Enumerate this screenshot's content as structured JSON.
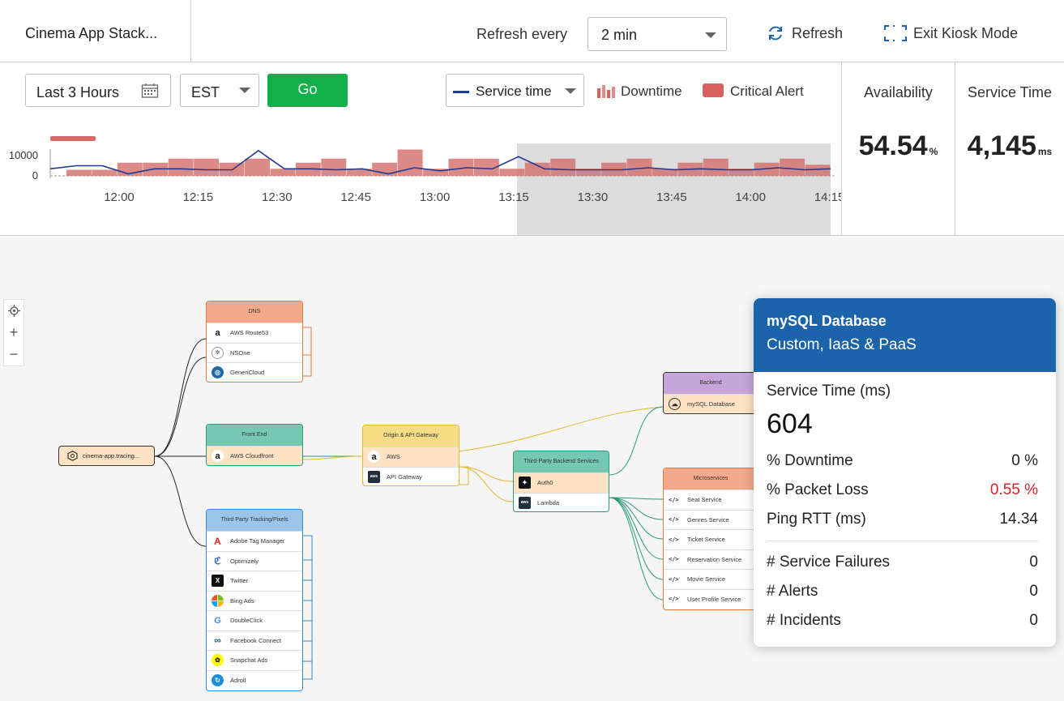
{
  "header": {
    "app_title": "Cinema App Stack...",
    "refresh_label": "Refresh every",
    "refresh_interval": "2 min",
    "refresh_button": "Refresh",
    "kiosk_button": "Exit Kiosk Mode"
  },
  "filters": {
    "range": "Last 3 Hours",
    "timezone": "EST",
    "go_button": "Go",
    "series_select": "Service time",
    "legend_downtime": "Downtime",
    "legend_critical": "Critical Alert"
  },
  "kpis": {
    "availability_label": "Availability",
    "availability_value": "54.54",
    "availability_unit": "%",
    "service_time_label": "Service Time",
    "service_time_value": "4,145",
    "service_time_unit": "ms"
  },
  "chart_data": {
    "type": "bar",
    "y_ticks": [
      "10000",
      "0"
    ],
    "x_ticks": [
      "12:00",
      "12:15",
      "12:30",
      "12:45",
      "13:00",
      "13:15",
      "13:30",
      "13:45",
      "14:00",
      "14:15"
    ],
    "downtime_bars": [
      0.3,
      0.3,
      0.65,
      0.65,
      0.85,
      0.85,
      0.65,
      0.85,
      0.35,
      0.65,
      0.85,
      0.35,
      0.65,
      1.3,
      0.35,
      0.85,
      0.85,
      0.35,
      0.65,
      0.85,
      0.35,
      0.65,
      0.85,
      0.35,
      0.65,
      0.85,
      0.35,
      0.65,
      0.85,
      0.55
    ],
    "service_time_line": [
      3500,
      5000,
      5000,
      1000,
      3500,
      3500,
      3000,
      3000,
      12500,
      3500,
      3500,
      3000,
      3500,
      1000,
      4000,
      2500,
      4000,
      3500,
      9500,
      3500,
      3000,
      3000,
      3000,
      4000,
      3000,
      3500,
      3000,
      3000,
      4000,
      3000,
      3500
    ],
    "selection": {
      "from": "13:15",
      "to": "14:15"
    }
  },
  "map": {
    "root": "cinema-app.tracing...",
    "groups": {
      "dns": {
        "title": "DNS",
        "color": "#f4a98a",
        "items": [
          {
            "label": "AWS Route53",
            "icon": "amazon-icon"
          },
          {
            "label": "NSOne",
            "icon": "nsone-icon"
          },
          {
            "label": "GeneriCloud",
            "icon": "genericloud-icon"
          }
        ]
      },
      "front_end": {
        "title": "Front End",
        "color": "#76c8b2",
        "items": [
          {
            "label": "AWS Cloudfront",
            "icon": "amazon-icon"
          }
        ]
      },
      "tracking": {
        "title": "Third Party Tracking/Pixels",
        "color": "#9cc5ea",
        "items": [
          {
            "label": "Adobe Tag Manager",
            "icon": "adobe-icon"
          },
          {
            "label": "Optimizely",
            "icon": "optimizely-icon"
          },
          {
            "label": "Twitter",
            "icon": "x-icon"
          },
          {
            "label": "Bing Ads",
            "icon": "microsoft-icon"
          },
          {
            "label": "DoubleClick",
            "icon": "google-icon"
          },
          {
            "label": "Facebook Connect",
            "icon": "meta-icon"
          },
          {
            "label": "Snapchat Ads",
            "icon": "snapchat-icon"
          },
          {
            "label": "Adroll",
            "icon": "adroll-icon"
          }
        ]
      },
      "origin": {
        "title": "Origin & API Gateway",
        "color": "#f7dc86",
        "items": [
          {
            "label": "AWS",
            "icon": "amazon-icon"
          },
          {
            "label": "API Gateway",
            "icon": "aws-icon"
          }
        ]
      },
      "third_party": {
        "title": "Third-Party Backend Services",
        "color": "#76c8b2",
        "items": [
          {
            "label": "Auth0",
            "icon": "auth0-icon"
          },
          {
            "label": "Lambda",
            "icon": "aws-icon"
          }
        ]
      },
      "backend": {
        "title": "Backend",
        "color": "#c6a6d8",
        "items": [
          {
            "label": "mySQL Database",
            "icon": "database-icon"
          }
        ]
      },
      "microservices": {
        "title": "Microservices",
        "color": "#f4a98a",
        "items": [
          {
            "label": "Seat Service",
            "icon": "code-icon"
          },
          {
            "label": "Genres Service",
            "icon": "code-icon"
          },
          {
            "label": "Ticket Service",
            "icon": "code-icon"
          },
          {
            "label": "Reservation Service",
            "icon": "code-icon"
          },
          {
            "label": "Movie Service",
            "icon": "code-icon"
          },
          {
            "label": "User Profile Service",
            "icon": "code-icon"
          }
        ]
      }
    }
  },
  "popup": {
    "title": "mySQL Database",
    "subtitle": "Custom, IaaS & PaaS",
    "service_time_label": "Service Time (ms)",
    "service_time_value": "604",
    "rows": [
      {
        "label": "% Downtime",
        "value": "0 %"
      },
      {
        "label": "% Packet Loss",
        "value": "0.55 %"
      },
      {
        "label": "Ping RTT (ms)",
        "value": "14.34"
      }
    ],
    "counts": [
      {
        "label": "# Service Failures",
        "value": "0"
      },
      {
        "label": "# Alerts",
        "value": "0"
      },
      {
        "label": "# Incidents",
        "value": "0"
      }
    ]
  }
}
